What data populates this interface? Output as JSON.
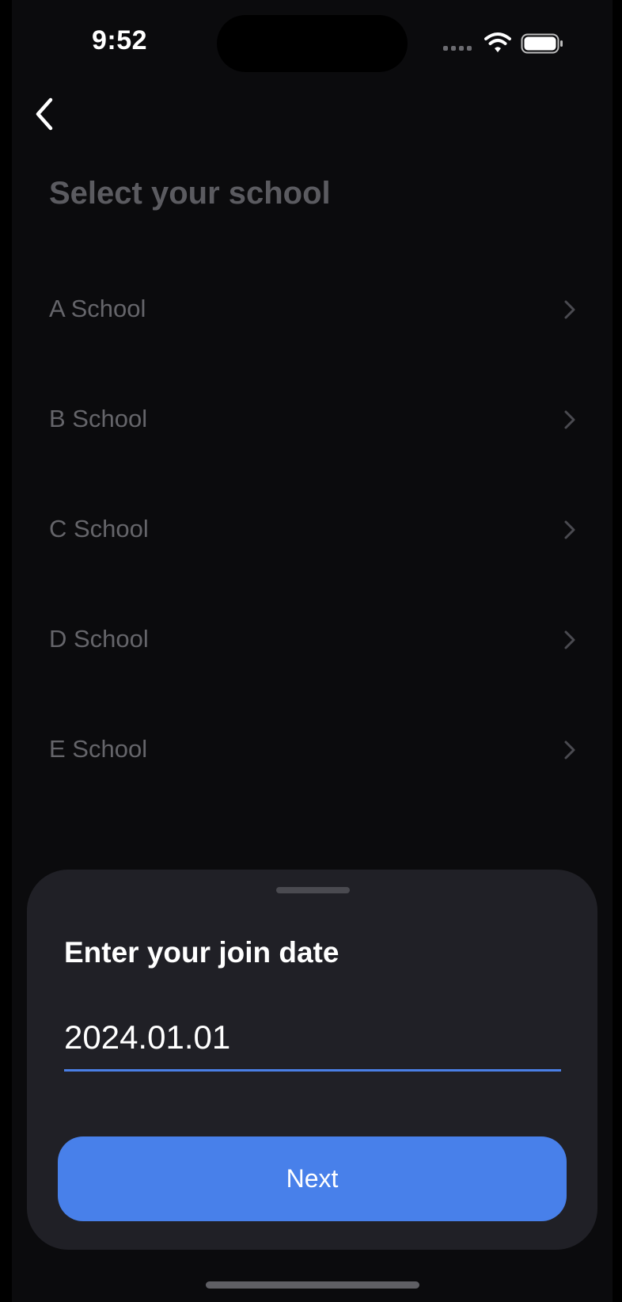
{
  "status_bar": {
    "time": "9:52",
    "wifi_icon": "wifi-icon",
    "battery_icon": "battery-icon"
  },
  "header": {
    "back_icon": "chevron-left-icon",
    "title": "Select your school"
  },
  "schools": [
    {
      "label": "A School"
    },
    {
      "label": "B School"
    },
    {
      "label": "C School"
    },
    {
      "label": "D School"
    },
    {
      "label": "E School"
    }
  ],
  "sheet": {
    "title": "Enter your join date",
    "date_value": "2024.01.01",
    "next_label": "Next"
  },
  "colors": {
    "background": "#0b0b0d",
    "sheet": "#202026",
    "accent": "#4880ea",
    "muted_text": "#65656a"
  }
}
